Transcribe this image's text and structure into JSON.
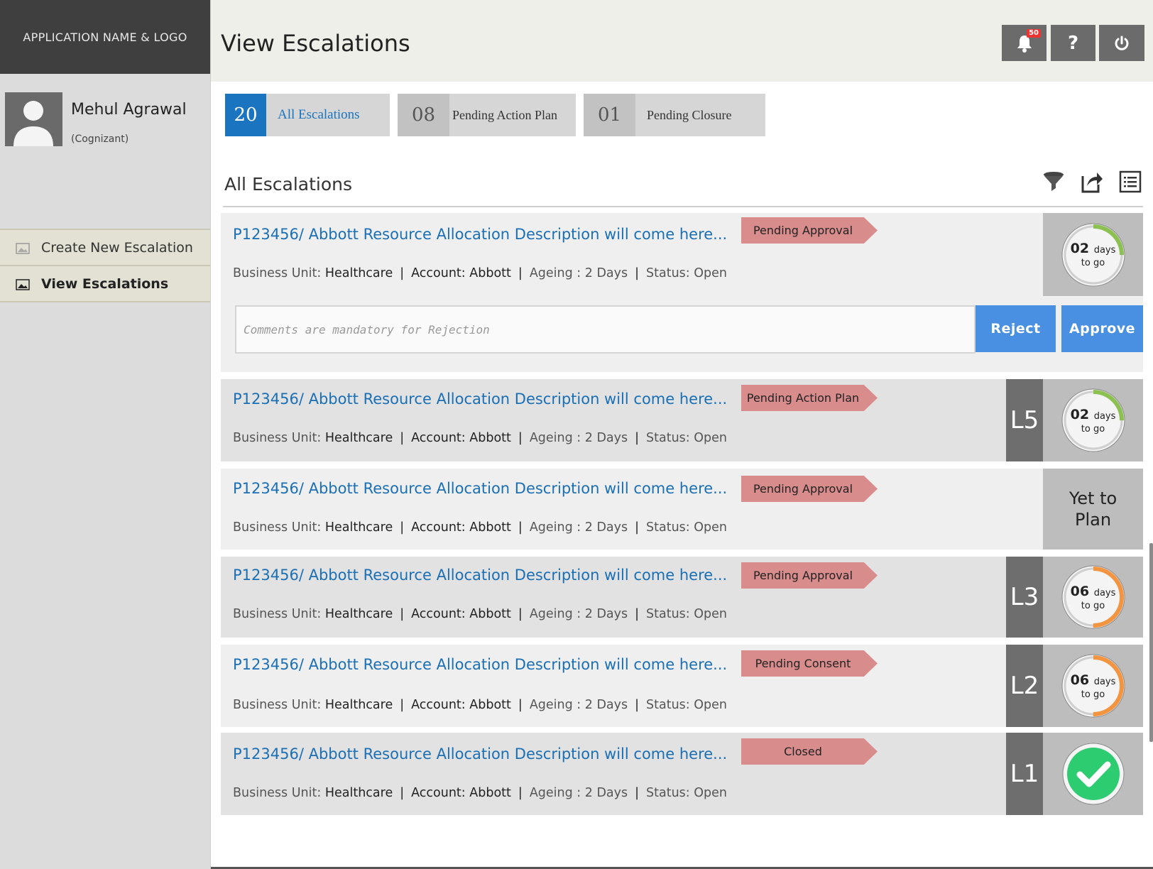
{
  "app": {
    "logo_label": "APPLICATION NAME & LOGO",
    "page_title": "View Escalations"
  },
  "user": {
    "name": "Mehul Agrawal",
    "org": "(Cognizant)"
  },
  "nav": [
    {
      "label": "Create New Escalation",
      "icon": "image-icon"
    },
    {
      "label": "View Escalations",
      "icon": "image-icon",
      "active": true
    }
  ],
  "header_actions": {
    "notifications_count": "50",
    "help_label": "?"
  },
  "tabs": [
    {
      "count": "20",
      "label": "All Escalations",
      "active": true
    },
    {
      "count": "08",
      "label": "Pending Action Plan"
    },
    {
      "count": "01",
      "label": "Pending Closure"
    }
  ],
  "section": {
    "title": "All Escalations"
  },
  "labels": {
    "bu": "Business Unit:",
    "account": "Account:",
    "ageing": "Ageing : 2 Days",
    "status": "Status: Open",
    "days": "days",
    "to_go": "to go"
  },
  "comment_placeholder": "Comments are mandatory for Rejection",
  "buttons": {
    "reject": "Reject",
    "approve": "Approve"
  },
  "escalations": [
    {
      "title": "P123456/ Abbott Resource Allocation Description will come here...",
      "tag": "Pending Approval",
      "business_unit": "Healthcare",
      "account": "Abbott",
      "level": "",
      "days": "02",
      "progress": 0.25,
      "ring_color": "#8cc152"
    },
    {
      "title": "P123456/ Abbott Resource Allocation Description will come here...",
      "tag": "Pending Action Plan",
      "business_unit": "Healthcare",
      "account": "Abbott",
      "level": "L5",
      "days": "02",
      "progress": 0.25,
      "ring_color": "#8cc152"
    },
    {
      "title": "P123456/ Abbott Resource Allocation Description will come here...",
      "tag": "Pending Approval",
      "business_unit": "Healthcare",
      "account": "Abbott",
      "level": "",
      "status_box_line1": "Yet to",
      "status_box_line2": "Plan"
    },
    {
      "title": "P123456/ Abbott Resource Allocation Description will come here...",
      "tag": "Pending Approval",
      "business_unit": "Healthcare",
      "account": "Abbott",
      "level": "L3",
      "days": "06",
      "progress": 0.5,
      "ring_color": "#f29440"
    },
    {
      "title": "P123456/ Abbott Resource Allocation Description will come here...",
      "tag": "Pending Consent",
      "business_unit": "Healthcare",
      "account": "Abbott",
      "level": "L2",
      "days": "06",
      "progress": 0.5,
      "ring_color": "#f29440"
    },
    {
      "title": "P123456/ Abbott Resource Allocation Description will come here...",
      "tag": "Closed",
      "business_unit": "Healthcare",
      "account": "Abbott",
      "level": "L1",
      "completed": true
    }
  ],
  "colors": {
    "accent": "#1a74c0",
    "button": "#4a90e2",
    "tag": "#d98c8c",
    "complete": "#2ecc71"
  }
}
